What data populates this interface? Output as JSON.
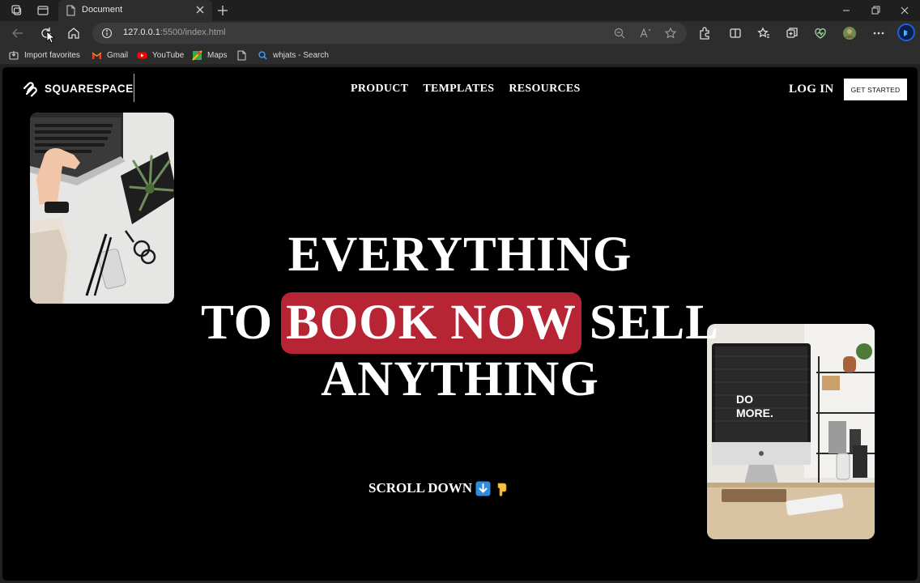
{
  "browser": {
    "tab_title": "Document",
    "url_host": "127.0.0.1",
    "url_path": ":5500/index.html",
    "favorites": [
      {
        "label": "Import favorites",
        "icon": "import-icon"
      },
      {
        "label": "Gmail",
        "icon": "gmail-icon"
      },
      {
        "label": "YouTube",
        "icon": "youtube-icon"
      },
      {
        "label": "Maps",
        "icon": "maps-icon"
      },
      {
        "label": "",
        "icon": "document-icon"
      },
      {
        "label": "whjats - Search",
        "icon": "search-icon"
      }
    ]
  },
  "site": {
    "logo_text": "SQUARESPACE",
    "nav": [
      "PRODUCT",
      "TEMPLATES",
      "RESOURCES"
    ],
    "login_label": "LOG IN",
    "cta_label": "GET STARTED",
    "headline": {
      "line1": "EVERYTHING",
      "line2_before": "TO",
      "line2_highlight": "BOOK NOW",
      "line2_after": "SELL",
      "line3": "ANYTHING"
    },
    "scroll_label": "SCROLL DOWN",
    "highlight_color": "#b72535",
    "images": {
      "left": "laptop-desk-photo",
      "right": "imac-do-more-photo",
      "screen_text_line1": "DO",
      "screen_text_line2": "MORE."
    }
  }
}
